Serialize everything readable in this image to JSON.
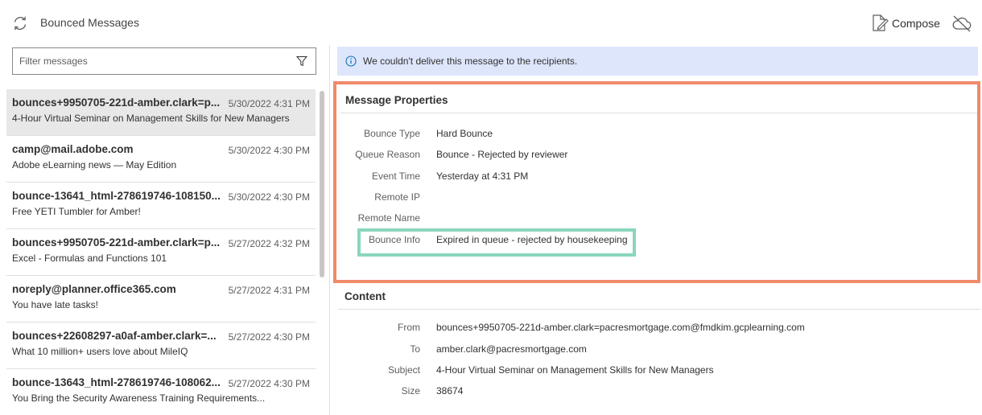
{
  "app": {
    "title": "Bounced Messages"
  },
  "toolbar": {
    "compose_label": "Compose"
  },
  "filter": {
    "placeholder": "Filter messages"
  },
  "messages": [
    {
      "sender": "bounces+9950705-221d-amber.clark=p...",
      "date": "5/30/2022 4:31 PM",
      "subject": "4-Hour Virtual Seminar on Management Skills for New Managers",
      "selected": true
    },
    {
      "sender": "camp@mail.adobe.com",
      "date": "5/30/2022 4:30 PM",
      "subject": "Adobe eLearning news —  May Edition",
      "selected": false
    },
    {
      "sender": "bounce-13641_html-278619746-108150...",
      "date": "5/30/2022 4:30 PM",
      "subject": "Free YETI Tumbler for Amber!",
      "selected": false
    },
    {
      "sender": "bounces+9950705-221d-amber.clark=p...",
      "date": "5/27/2022 4:32 PM",
      "subject": "Excel - Formulas and Functions 101",
      "selected": false
    },
    {
      "sender": "noreply@planner.office365.com",
      "date": "5/27/2022 4:31 PM",
      "subject": "You have late tasks!",
      "selected": false
    },
    {
      "sender": "bounces+22608297-a0af-amber.clark=...",
      "date": "5/27/2022 4:30 PM",
      "subject": "What 10 million+ users love about MileIQ",
      "selected": false
    },
    {
      "sender": "bounce-13643_html-278619746-108062...",
      "date": "5/27/2022 4:30 PM",
      "subject": "You Bring the Security Awareness Training Requirements...",
      "selected": false
    }
  ],
  "banner": {
    "text": "We couldn't deliver this message to the recipients."
  },
  "properties": {
    "title": "Message Properties",
    "bounce_type": {
      "label": "Bounce Type",
      "value": "Hard Bounce"
    },
    "queue_reason": {
      "label": "Queue Reason",
      "value": "Bounce - Rejected by reviewer"
    },
    "event_time": {
      "label": "Event Time",
      "value": "Yesterday at 4:31 PM"
    },
    "remote_ip": {
      "label": "Remote IP",
      "value": ""
    },
    "remote_name": {
      "label": "Remote Name",
      "value": ""
    },
    "bounce_info": {
      "label": "Bounce Info",
      "value": "Expired in queue - rejected by housekeeping"
    }
  },
  "content": {
    "title": "Content",
    "from": {
      "label": "From",
      "value": "bounces+9950705-221d-amber.clark=pacresmortgage.com@fmdkim.gcplearning.com"
    },
    "to": {
      "label": "To",
      "value": "amber.clark@pacresmortgage.com"
    },
    "subject": {
      "label": "Subject",
      "value": "4-Hour Virtual Seminar on Management Skills for New Managers"
    },
    "size": {
      "label": "Size",
      "value": "38674"
    }
  },
  "colors": {
    "properties_highlight": "#f08a6a",
    "bounce_info_highlight": "#8ad6bd",
    "banner_background": "#dde6fb",
    "info_icon": "#0f6cbd",
    "selected_row": "#e8e8e8"
  },
  "icons": {
    "refresh": "refresh-icon",
    "compose": "compose-icon",
    "cloud_off": "cloud-off-icon",
    "filter": "filter-icon",
    "info": "info-icon"
  }
}
